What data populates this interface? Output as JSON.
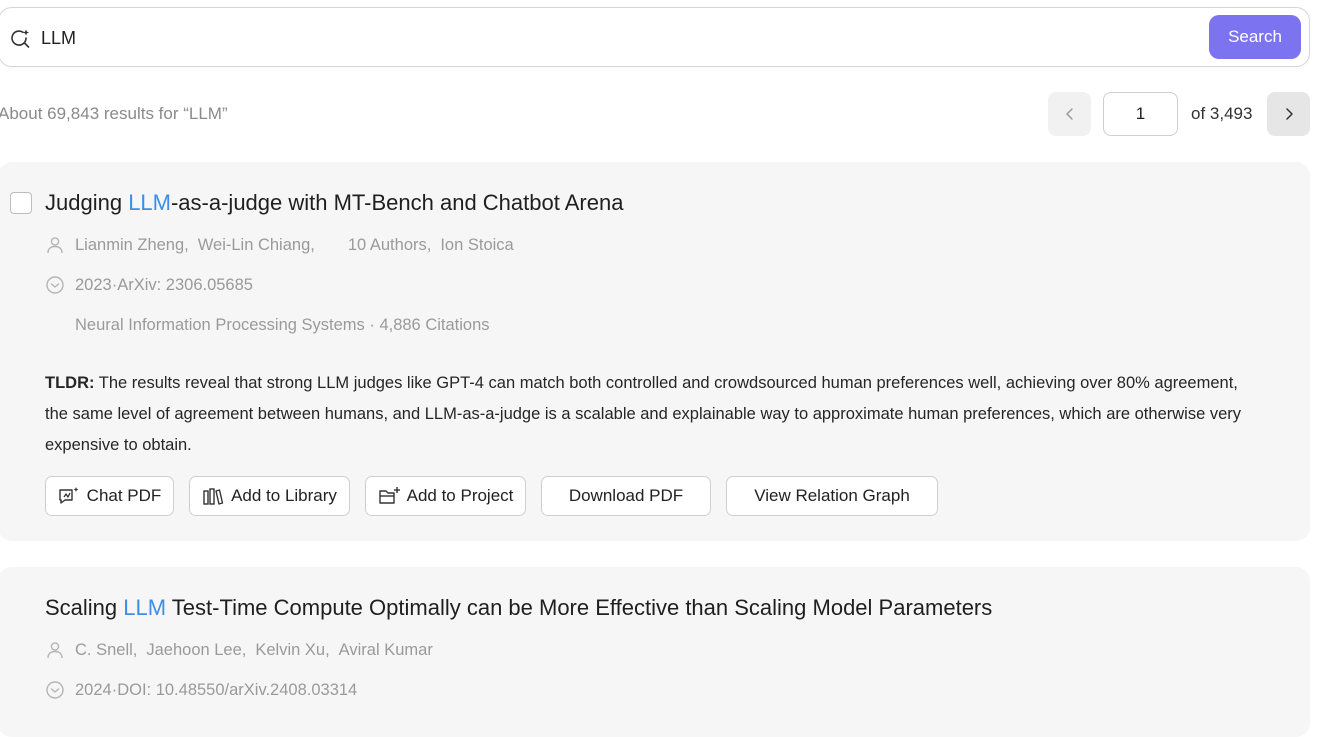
{
  "search": {
    "value": "LLM",
    "button_label": "Search"
  },
  "results": {
    "count_text": "About 69,843 results for “LLM”"
  },
  "pagination": {
    "current_page": "1",
    "of_text": "of 3,493"
  },
  "papers": [
    {
      "title_prefix": "Judging ",
      "title_highlight": "LLM",
      "title_suffix": "-as-a-judge with MT-Bench and Chatbot Arena",
      "authors": [
        "Lianmin Zheng,",
        "Wei-Lin Chiang,",
        "10 Authors,",
        "Ion Stoica"
      ],
      "date_source": "2023·ArXiv: 2306.05685",
      "venue_citations": "Neural Information Processing Systems · 4,886 Citations",
      "tldr_label": "TLDR:",
      "tldr_text": " The results reveal that strong LLM judges like GPT-4 can match both controlled and crowdsourced human preferences well, achieving over 80% agreement, the same level of agreement between humans, and LLM-as-a-judge is a scalable and explainable way to approximate human preferences, which are otherwise very expensive to obtain.",
      "actions": [
        "Chat PDF",
        "Add to Library",
        "Add to Project",
        "Download PDF",
        "View Relation Graph"
      ]
    },
    {
      "title_prefix": "Scaling ",
      "title_highlight": "LLM",
      "title_suffix": " Test-Time Compute Optimally can be More Effective than Scaling Model Parameters",
      "authors": [
        "C. Snell,",
        "Jaehoon Lee,",
        "Kelvin Xu,",
        "Aviral Kumar"
      ],
      "date_source": "2024·DOI: 10.48550/arXiv.2408.03314"
    }
  ],
  "icons": {
    "search": "search-sparkle-icon",
    "prev": "chevron-left-icon",
    "next": "chevron-right-icon",
    "author": "user-icon",
    "date": "clock-icon",
    "chat_pdf": "chat-pdf-icon",
    "library": "library-icon",
    "project": "folder-add-icon"
  },
  "colors": {
    "accent": "#7b73f0",
    "highlight": "#3d8fe6",
    "card_bg": "#f6f6f6"
  }
}
